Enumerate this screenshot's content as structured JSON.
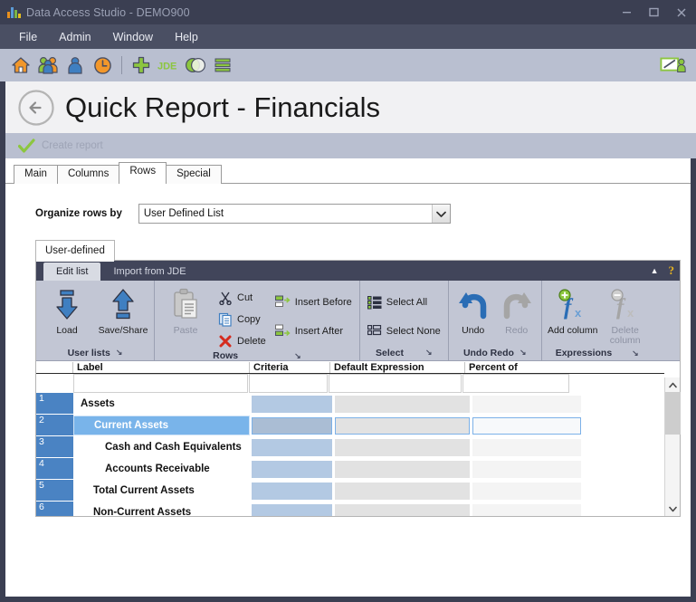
{
  "window": {
    "title": "Data Access Studio - DEMO900",
    "minimize": "–",
    "maximize": "❑",
    "close": "✕"
  },
  "menu": {
    "items": [
      "File",
      "Admin",
      "Window",
      "Help"
    ]
  },
  "toolbar": {
    "icons": [
      {
        "name": "home-icon",
        "label": "Home"
      },
      {
        "name": "users-group-icon",
        "label": "Users"
      },
      {
        "name": "user-icon",
        "label": "User"
      },
      {
        "name": "clock-icon",
        "label": "Scheduler"
      },
      {
        "name": "plus-icon",
        "label": "New"
      },
      {
        "name": "jde-icon",
        "label": "JDE"
      },
      {
        "name": "venn-icon",
        "label": "Join"
      },
      {
        "name": "list-icon",
        "label": "List"
      }
    ],
    "right_icon": {
      "name": "presenter-screen-icon",
      "label": "Present"
    }
  },
  "header": {
    "back_icon": "back-arrow-icon",
    "title": "Quick Report - Financials",
    "action_icon": "check-icon",
    "action_label": "Create report"
  },
  "main_tabs": {
    "items": [
      {
        "label": "Main",
        "active": false
      },
      {
        "label": "Columns",
        "active": false
      },
      {
        "label": "Rows",
        "active": true
      },
      {
        "label": "Special",
        "active": false
      }
    ]
  },
  "organize": {
    "label": "Organize rows by",
    "value": "User Defined List",
    "options": [
      "User Defined List"
    ],
    "arrow": "⌄"
  },
  "sub_tabs": {
    "items": [
      {
        "label": "User-defined",
        "active": true
      }
    ]
  },
  "ribbon": {
    "tabs": [
      {
        "label": "Edit list",
        "active": true
      },
      {
        "label": "Import from JDE",
        "active": false
      }
    ],
    "collapse_icon": "chevron-up-icon",
    "help_icon": "help-question-icon",
    "help_glyph": "?",
    "collapse_glyph": "▲",
    "dialog_launcher_glyph": "↘",
    "groups": [
      {
        "title": "User lists",
        "big_buttons": [
          {
            "label": "Load",
            "icon": "download-arrow-icon",
            "disabled": false
          },
          {
            "label": "Save/Share",
            "icon": "upload-arrow-icon",
            "disabled": false
          }
        ],
        "small_buttons": []
      },
      {
        "title": "Rows",
        "big_buttons": [
          {
            "label": "Paste",
            "icon": "clipboard-paste-icon",
            "disabled": true
          }
        ],
        "small_buttons": [
          {
            "label": "Cut",
            "icon": "scissors-icon",
            "disabled": false
          },
          {
            "label": "Copy",
            "icon": "copy-pages-icon",
            "disabled": false
          },
          {
            "label": "Delete",
            "icon": "red-x-icon",
            "disabled": false
          },
          {
            "label": "Insert Before",
            "icon": "insert-before-icon",
            "disabled": false
          },
          {
            "label": "Insert After",
            "icon": "insert-after-icon",
            "disabled": false
          }
        ]
      },
      {
        "title": "Select",
        "big_buttons": [],
        "small_buttons": [
          {
            "label": "Select All",
            "icon": "select-all-icon",
            "disabled": false
          },
          {
            "label": "Select None",
            "icon": "select-none-icon",
            "disabled": false
          }
        ]
      },
      {
        "title": "Undo Redo",
        "big_buttons": [
          {
            "label": "Undo",
            "icon": "undo-arrow-icon",
            "disabled": false
          },
          {
            "label": "Redo",
            "icon": "redo-arrow-icon",
            "disabled": true
          }
        ],
        "small_buttons": []
      },
      {
        "title": "Expressions",
        "big_buttons": [
          {
            "label": "Add column",
            "icon": "add-function-icon",
            "disabled": false
          },
          {
            "label": "Delete column",
            "icon": "remove-function-icon",
            "disabled": true
          }
        ],
        "small_buttons": []
      }
    ]
  },
  "grid": {
    "columns": [
      "",
      "Label",
      "Criteria",
      "Default Expression",
      "Percent of"
    ],
    "filters": [
      "",
      "",
      ""
    ],
    "rows": [
      {
        "num": "1",
        "label": "Assets",
        "indent": 1,
        "selected": false,
        "criteria": "",
        "default_expression": "",
        "percent_of": ""
      },
      {
        "num": "2",
        "label": "Current Assets",
        "indent": 2,
        "selected": true,
        "criteria": "",
        "default_expression": "",
        "percent_of": ""
      },
      {
        "num": "3",
        "label": "Cash and Cash Equivalents",
        "indent": 3,
        "selected": false,
        "criteria": "",
        "default_expression": "",
        "percent_of": ""
      },
      {
        "num": "4",
        "label": "Accounts Receivable",
        "indent": 3,
        "selected": false,
        "criteria": "",
        "default_expression": "",
        "percent_of": ""
      },
      {
        "num": "5",
        "label": "Total Current Assets",
        "indent": 2,
        "selected": false,
        "criteria": "",
        "default_expression": "",
        "percent_of": ""
      },
      {
        "num": "6",
        "label": "Non-Current Assets",
        "indent": 2,
        "selected": false,
        "criteria": "",
        "default_expression": "",
        "percent_of": ""
      }
    ],
    "scroll_up_glyph": "⌃",
    "scroll_down_glyph": "⌄"
  },
  "colors": {
    "titlebar": "#3b3f52",
    "menubar": "#4a4f63",
    "toolbar": "#b9bfd0",
    "accent_orange": "#f2972a",
    "accent_green": "#8cc63f",
    "accent_blue": "#3f7fc1",
    "row_number": "#4a83c3",
    "selected_row": "#79b4ea",
    "criteria_cell": "#b3c9e3",
    "ribbon": "#c2c6d4",
    "ribbon_tabbar": "#41455a"
  }
}
